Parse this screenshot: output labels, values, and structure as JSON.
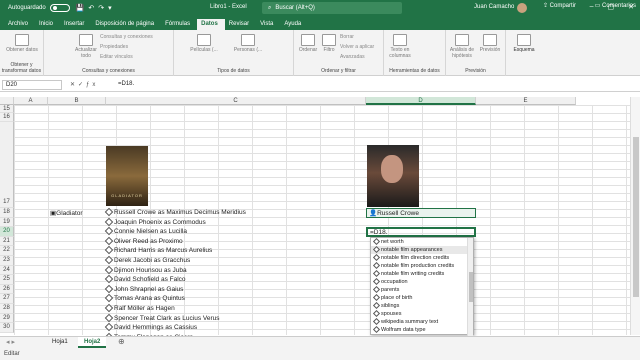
{
  "title_bar": {
    "autosave_label": "Autoguardado",
    "autosave_state": "off",
    "doc_title": "Libro1  -  Excel",
    "search_placeholder": "Buscar (Alt+Q)",
    "user_name": "Juan Camacho"
  },
  "tabs": [
    "Archivo",
    "Inicio",
    "Insertar",
    "Disposición de página",
    "Fórmulas",
    "Datos",
    "Revisar",
    "Vista",
    "Ayuda"
  ],
  "active_tab": "Datos",
  "share_label": "Compartir",
  "comments_label": "Comentarios",
  "ribbon": {
    "groups": [
      {
        "label": "Obtener y transformar datos",
        "buttons": [
          "Obtener datos"
        ]
      },
      {
        "label": "Consultas y conexiones",
        "buttons": [
          "Actualizar todo"
        ],
        "small": [
          "Consultas y conexiones",
          "Propiedades",
          "Editar vínculos"
        ]
      },
      {
        "label": "Tipos de datos",
        "buttons": [
          "Películas (...",
          "Personas (..."
        ]
      },
      {
        "label": "Ordenar y filtrar",
        "buttons": [
          "Ordenar",
          "Filtro"
        ],
        "small": [
          "Borrar",
          "Volver a aplicar",
          "Avanzadas"
        ]
      },
      {
        "label": "Herramientas de datos",
        "buttons": [
          "Texto en columnas"
        ]
      },
      {
        "label": "Previsión",
        "buttons": [
          "Análisis de hipótesis",
          "Previsión"
        ]
      },
      {
        "label": "",
        "buttons": [
          "Esquema"
        ]
      }
    ]
  },
  "formula_bar": {
    "name_box": "D20",
    "formula": "=D18."
  },
  "columns": [
    "A",
    "B",
    "C",
    "D",
    "E"
  ],
  "selected_column": "D",
  "rows": [
    "17",
    "18",
    "19",
    "20",
    "21",
    "22",
    "23",
    "24",
    "25",
    "26",
    "27",
    "28",
    "29",
    "30"
  ],
  "top_rows": [
    "15",
    "16"
  ],
  "selected_row": "20",
  "cells": {
    "b18": "Gladiator",
    "d18": "Russell Crowe",
    "d20": "=D18.",
    "cast": [
      "Russell Crowe as Maximus Decimus Meridius",
      "Joaquin Phoenix as Commodus",
      "Connie Nielsen as Lucilla",
      "Oliver Reed as Proximo",
      "Richard Harris as Marcus Aurelius",
      "Derek Jacobi as Gracchus",
      "Djimon Hounsou as Juba",
      "David Schofield as Falco",
      "John Shrapnel as Gaius",
      "Tomas Arana as Quintus",
      "Ralf Möller as Hagen",
      "Spencer Treat Clark as Lucius Verus",
      "David Hemmings as Cassius",
      "Tommy Flanagan as Cicero"
    ]
  },
  "poster_text": "GLADIATOR",
  "autocomplete": [
    "net worth",
    "notable film appearances",
    "notable film direction credits",
    "notable film production credits",
    "notable film writing credits",
    "occupation",
    "parents",
    "place of birth",
    "siblings",
    "spouses",
    "wikipedia summary text",
    "Wolfram data type"
  ],
  "autocomplete_highlight": 1,
  "sheets": [
    "Hoja1",
    "Hoja2"
  ],
  "active_sheet": "Hoja2",
  "status": "Editar",
  "colors": {
    "excel_green": "#217346"
  }
}
